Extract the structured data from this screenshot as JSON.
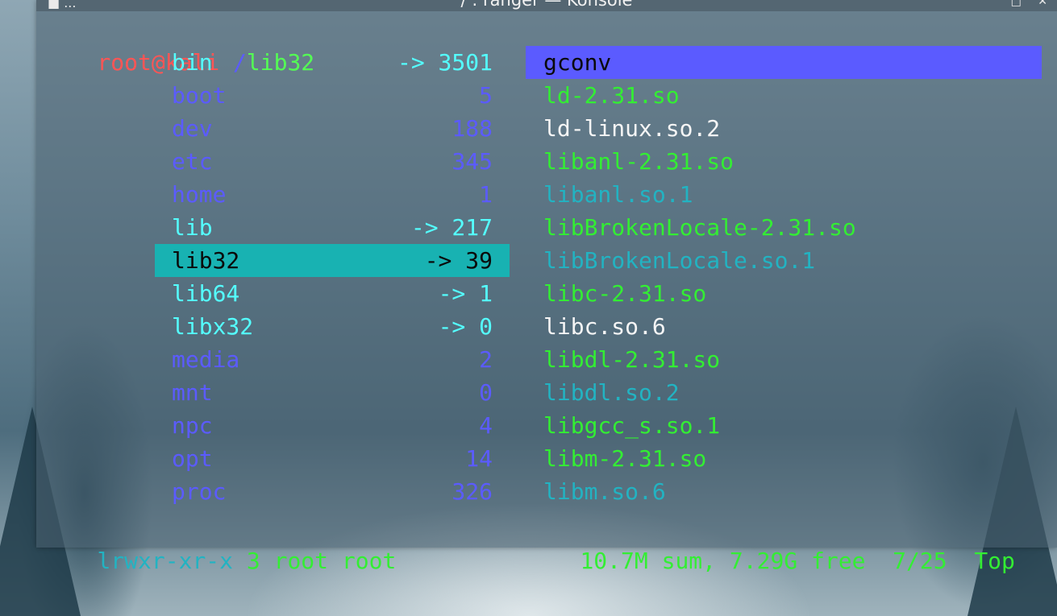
{
  "window": {
    "title": "/ : ranger — Konsole",
    "left_icons": "■ ...",
    "right_icons": "□ ✕"
  },
  "prompt": {
    "user_host": "root@kali",
    "path_prefix": "/",
    "path_current": "lib32"
  },
  "left_column": [
    {
      "name": "bin",
      "info": "-> 3501",
      "kind": "symlink"
    },
    {
      "name": "boot",
      "info": "5",
      "kind": "dir"
    },
    {
      "name": "dev",
      "info": "188",
      "kind": "dir"
    },
    {
      "name": "etc",
      "info": "345",
      "kind": "dir"
    },
    {
      "name": "home",
      "info": "1",
      "kind": "dir"
    },
    {
      "name": "lib",
      "info": "-> 217",
      "kind": "symlink"
    },
    {
      "name": "lib32",
      "info": "-> 39",
      "kind": "symlink",
      "selected": true
    },
    {
      "name": "lib64",
      "info": "-> 1",
      "kind": "symlink"
    },
    {
      "name": "libx32",
      "info": "-> 0",
      "kind": "symlink"
    },
    {
      "name": "media",
      "info": "2",
      "kind": "dir"
    },
    {
      "name": "mnt",
      "info": "0",
      "kind": "dir"
    },
    {
      "name": "npc",
      "info": "4",
      "kind": "dir"
    },
    {
      "name": "opt",
      "info": "14",
      "kind": "dir"
    },
    {
      "name": "proc",
      "info": "326",
      "kind": "dir"
    }
  ],
  "right_column": [
    {
      "name": "gconv",
      "kind": "dir",
      "selected": true
    },
    {
      "name": "ld-2.31.so",
      "kind": "exec"
    },
    {
      "name": "ld-linux.so.2",
      "kind": "symlink-white"
    },
    {
      "name": "libanl-2.31.so",
      "kind": "exec"
    },
    {
      "name": "libanl.so.1",
      "kind": "symlink-cyan"
    },
    {
      "name": "libBrokenLocale-2.31.so",
      "kind": "exec"
    },
    {
      "name": "libBrokenLocale.so.1",
      "kind": "symlink-cyan"
    },
    {
      "name": "libc-2.31.so",
      "kind": "exec"
    },
    {
      "name": "libc.so.6",
      "kind": "symlink-white"
    },
    {
      "name": "libdl-2.31.so",
      "kind": "exec"
    },
    {
      "name": "libdl.so.2",
      "kind": "symlink-cyan"
    },
    {
      "name": "libgcc_s.so.1",
      "kind": "exec"
    },
    {
      "name": "libm-2.31.so",
      "kind": "exec"
    },
    {
      "name": "libm.so.6",
      "kind": "symlink-cyan"
    }
  ],
  "status_bar": {
    "permissions": "lrwxr-xr-x",
    "links_owner": "3 root root",
    "summary": "10.7M sum, 7.29G free",
    "position": "7/25",
    "scroll": "Top"
  },
  "colors": {
    "symlink": "#54ffff",
    "dir": "#5b5bff",
    "exec": "#33ee33",
    "symlink_cyan": "#22b3c2",
    "selected_left_bg": "#18b2b2",
    "selected_right_bg": "#5b5bff",
    "prompt_user": "#ff5555",
    "prompt_path": "#54ff54"
  }
}
